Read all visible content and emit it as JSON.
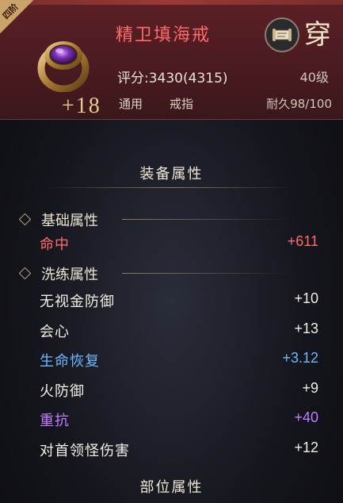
{
  "item": {
    "tier": "四阶",
    "name": "精卫填海戒",
    "enhance": "+18",
    "equip_label": "穿",
    "score": "评分:3430(4315)",
    "level": "40级",
    "type": "通用",
    "slot": "戒指",
    "durability": "耐久98/100"
  },
  "sections": {
    "equip_attrs": "装备属性",
    "part_attrs": "部位属性"
  },
  "base": {
    "header": "基础属性",
    "rows": [
      {
        "label": "命中",
        "value": "+611",
        "color": "#ff6b6b"
      }
    ]
  },
  "refine": {
    "header": "洗练属性",
    "rows": [
      {
        "label": "无视金防御",
        "value": "+10",
        "color": "#f2eee4"
      },
      {
        "label": "会心",
        "value": "+13",
        "color": "#f2eee4"
      },
      {
        "label": "生命恢复",
        "value": "+3.12",
        "color": "#6fb8ff"
      },
      {
        "label": "火防御",
        "value": "+9",
        "color": "#f2eee4"
      },
      {
        "label": "重抗",
        "value": "+40",
        "color": "#c17cff"
      },
      {
        "label": "对首领怪伤害",
        "value": "+12",
        "color": "#f2eee4"
      }
    ]
  },
  "colors": {
    "header_bg": "#4a1b20",
    "name": "#ff6a6a",
    "red": "#ff6b6b",
    "blue": "#6fb8ff",
    "purple": "#c17cff",
    "gold": "#e8c98a"
  },
  "icons": {
    "item": "ring-icon",
    "equip": "scroll-icon"
  }
}
